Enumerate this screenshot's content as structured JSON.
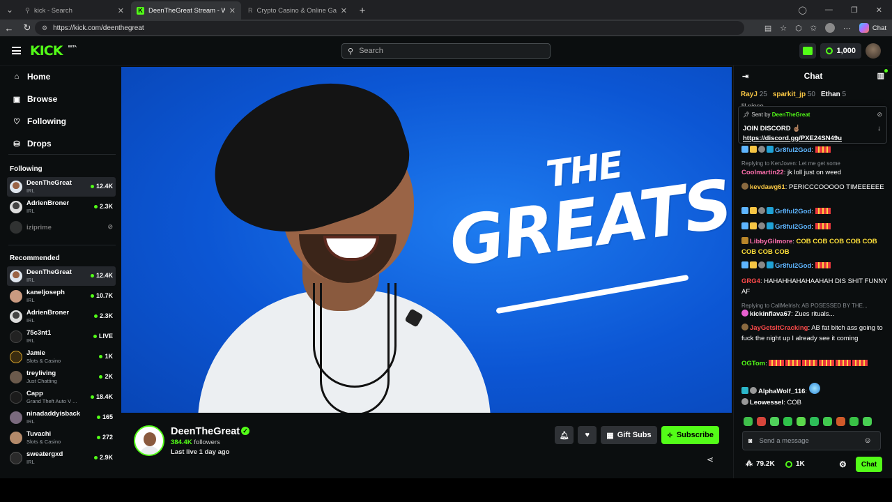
{
  "browser": {
    "tabs": [
      {
        "title": "kick - Search"
      },
      {
        "title": "DeenTheGreat Stream - Watch Live"
      },
      {
        "title": "Crypto Casino & Online Gambling"
      }
    ],
    "url": "https://kick.com/deenthegreat",
    "copilot_label": "Chat"
  },
  "header": {
    "logo_text": "KICK",
    "beta": "BETA",
    "search_placeholder": "Search",
    "kicks_balance": "1,000"
  },
  "sidebar": {
    "nav": [
      {
        "label": "Home",
        "icon": "home-icon"
      },
      {
        "label": "Browse",
        "icon": "browse-icon"
      },
      {
        "label": "Following",
        "icon": "heart-icon"
      },
      {
        "label": "Drops",
        "icon": "drops-icon"
      }
    ],
    "following_title": "Following",
    "following": [
      {
        "name": "DeenTheGreat",
        "category": "IRL",
        "viewers": "12.4K"
      },
      {
        "name": "AdrienBroner",
        "category": "IRL",
        "viewers": "2.3K"
      },
      {
        "name": "iziprime",
        "category": "",
        "viewers": ""
      }
    ],
    "recommended_title": "Recommended",
    "recommended": [
      {
        "name": "DeenTheGreat",
        "category": "IRL",
        "viewers": "12.4K"
      },
      {
        "name": "kaneljoseph",
        "category": "IRL",
        "viewers": "10.7K"
      },
      {
        "name": "AdrienBroner",
        "category": "IRL",
        "viewers": "2.3K"
      },
      {
        "name": "75c3nt1",
        "category": "IRL",
        "viewers": "LIVE"
      },
      {
        "name": "Jamie",
        "category": "Slots & Casino",
        "viewers": "1K"
      },
      {
        "name": "treyliving",
        "category": "Just Chatting",
        "viewers": "2K"
      },
      {
        "name": "Capp",
        "category": "Grand Theft Auto V ...",
        "viewers": "18.4K"
      },
      {
        "name": "ninadaddyisback",
        "category": "IRL",
        "viewers": "165"
      },
      {
        "name": "Tuvachi",
        "category": "Slots & Casino",
        "viewers": "272"
      },
      {
        "name": "sweatergxd",
        "category": "IRL",
        "viewers": "2.9K"
      }
    ]
  },
  "video": {
    "overlay_line1": "THE",
    "overlay_line2": "GREATS"
  },
  "streamer": {
    "name": "DeenTheGreat",
    "followers_count": "384.4K",
    "followers_label": "followers",
    "last_live": "Last live 1 day ago",
    "gift_label": "Gift Subs",
    "subscribe_label": "Subscribe"
  },
  "chat": {
    "title": "Chat",
    "leaderboard": [
      {
        "name": "RayJ",
        "count": "25"
      },
      {
        "name": "sparkit_jp",
        "count": "50"
      },
      {
        "name": "Ethan",
        "count": "5"
      }
    ],
    "partial_line": "lil niece",
    "pinned": {
      "sent_by": "Sent by",
      "sender": "DeenTheGreat",
      "message": "JOIN DISCORD ☝🏽",
      "link": "https://discord.gg/PXE24SN49u"
    },
    "messages": [
      {
        "user": "Gr8ful2God",
        "color": "#5eb5ff",
        "text": "",
        "emote": true
      },
      {
        "reply": "Replying to KenJoven: Let me get some"
      },
      {
        "user": "Coolmartin22",
        "color": "#ff6fae",
        "text": "jk loll just on weed"
      },
      {
        "user": "kevdawg61",
        "color": "#f6c544",
        "text": "PERICCCOOOOO TIMEEEEEE"
      },
      {
        "user": "Gr8ful2God",
        "color": "#5eb5ff",
        "text": "",
        "emote": true
      },
      {
        "user": "Gr8ful2God",
        "color": "#5eb5ff",
        "text": "",
        "emote": true
      },
      {
        "user": "LibbyGilmore",
        "color": "#ff6fae",
        "text": "COB COB COB COB COB COB COB COB",
        "yellow": true
      },
      {
        "user": "Gr8ful2God",
        "color": "#5eb5ff",
        "text": "",
        "emote": true
      },
      {
        "user": "GRG4",
        "color": "#ff4b4b",
        "text": "HAHAHHAHAHAAHAH DIS SHIT FUNNY AF"
      },
      {
        "reply": "Replying to CallMeIrish: AB POSESSED BY THE..."
      },
      {
        "user": "kickinflava67",
        "color": "#ffffff",
        "text": "Zues rituals..."
      },
      {
        "user": "JayGetsItCracking",
        "color": "#ff4b4b",
        "text": "AB fat bitch ass going to fuck the night up I already see it coming"
      },
      {
        "user": "OGTom",
        "color": "#53fc18",
        "text": "",
        "emote": true
      },
      {
        "user": "AlphaWolf_116",
        "color": "#ffffff",
        "text": ""
      },
      {
        "user": "Leowessel",
        "color": "#ffffff",
        "text": "COB"
      }
    ],
    "input_placeholder": "Send a message",
    "stat_a": "79.2K",
    "stat_b": "1K",
    "chat_button": "Chat"
  }
}
